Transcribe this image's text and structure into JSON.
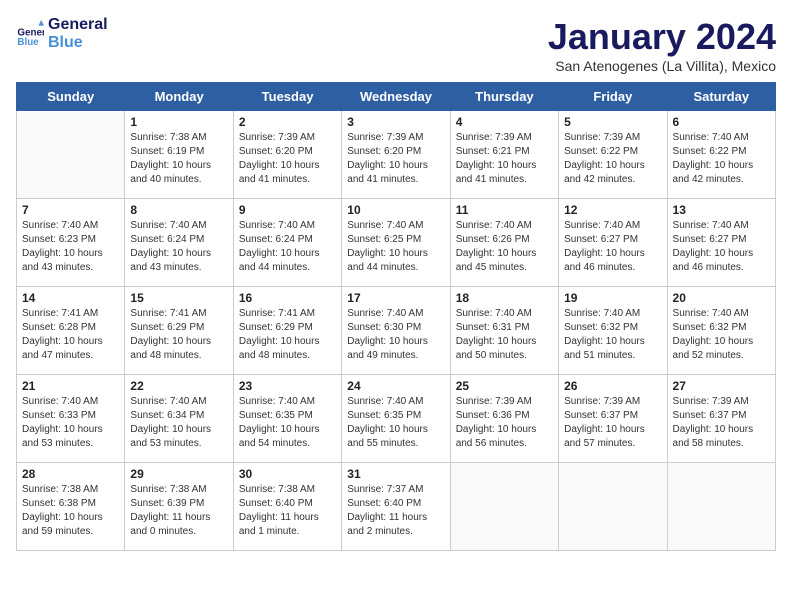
{
  "header": {
    "logo_line1": "General",
    "logo_line2": "Blue",
    "month_title": "January 2024",
    "location": "San Atenogenes (La Villita), Mexico"
  },
  "days_of_week": [
    "Sunday",
    "Monday",
    "Tuesday",
    "Wednesday",
    "Thursday",
    "Friday",
    "Saturday"
  ],
  "weeks": [
    [
      {
        "day": "",
        "info": ""
      },
      {
        "day": "1",
        "info": "Sunrise: 7:38 AM\nSunset: 6:19 PM\nDaylight: 10 hours\nand 40 minutes."
      },
      {
        "day": "2",
        "info": "Sunrise: 7:39 AM\nSunset: 6:20 PM\nDaylight: 10 hours\nand 41 minutes."
      },
      {
        "day": "3",
        "info": "Sunrise: 7:39 AM\nSunset: 6:20 PM\nDaylight: 10 hours\nand 41 minutes."
      },
      {
        "day": "4",
        "info": "Sunrise: 7:39 AM\nSunset: 6:21 PM\nDaylight: 10 hours\nand 41 minutes."
      },
      {
        "day": "5",
        "info": "Sunrise: 7:39 AM\nSunset: 6:22 PM\nDaylight: 10 hours\nand 42 minutes."
      },
      {
        "day": "6",
        "info": "Sunrise: 7:40 AM\nSunset: 6:22 PM\nDaylight: 10 hours\nand 42 minutes."
      }
    ],
    [
      {
        "day": "7",
        "info": "Sunrise: 7:40 AM\nSunset: 6:23 PM\nDaylight: 10 hours\nand 43 minutes."
      },
      {
        "day": "8",
        "info": "Sunrise: 7:40 AM\nSunset: 6:24 PM\nDaylight: 10 hours\nand 43 minutes."
      },
      {
        "day": "9",
        "info": "Sunrise: 7:40 AM\nSunset: 6:24 PM\nDaylight: 10 hours\nand 44 minutes."
      },
      {
        "day": "10",
        "info": "Sunrise: 7:40 AM\nSunset: 6:25 PM\nDaylight: 10 hours\nand 44 minutes."
      },
      {
        "day": "11",
        "info": "Sunrise: 7:40 AM\nSunset: 6:26 PM\nDaylight: 10 hours\nand 45 minutes."
      },
      {
        "day": "12",
        "info": "Sunrise: 7:40 AM\nSunset: 6:27 PM\nDaylight: 10 hours\nand 46 minutes."
      },
      {
        "day": "13",
        "info": "Sunrise: 7:40 AM\nSunset: 6:27 PM\nDaylight: 10 hours\nand 46 minutes."
      }
    ],
    [
      {
        "day": "14",
        "info": "Sunrise: 7:41 AM\nSunset: 6:28 PM\nDaylight: 10 hours\nand 47 minutes."
      },
      {
        "day": "15",
        "info": "Sunrise: 7:41 AM\nSunset: 6:29 PM\nDaylight: 10 hours\nand 48 minutes."
      },
      {
        "day": "16",
        "info": "Sunrise: 7:41 AM\nSunset: 6:29 PM\nDaylight: 10 hours\nand 48 minutes."
      },
      {
        "day": "17",
        "info": "Sunrise: 7:40 AM\nSunset: 6:30 PM\nDaylight: 10 hours\nand 49 minutes."
      },
      {
        "day": "18",
        "info": "Sunrise: 7:40 AM\nSunset: 6:31 PM\nDaylight: 10 hours\nand 50 minutes."
      },
      {
        "day": "19",
        "info": "Sunrise: 7:40 AM\nSunset: 6:32 PM\nDaylight: 10 hours\nand 51 minutes."
      },
      {
        "day": "20",
        "info": "Sunrise: 7:40 AM\nSunset: 6:32 PM\nDaylight: 10 hours\nand 52 minutes."
      }
    ],
    [
      {
        "day": "21",
        "info": "Sunrise: 7:40 AM\nSunset: 6:33 PM\nDaylight: 10 hours\nand 53 minutes."
      },
      {
        "day": "22",
        "info": "Sunrise: 7:40 AM\nSunset: 6:34 PM\nDaylight: 10 hours\nand 53 minutes."
      },
      {
        "day": "23",
        "info": "Sunrise: 7:40 AM\nSunset: 6:35 PM\nDaylight: 10 hours\nand 54 minutes."
      },
      {
        "day": "24",
        "info": "Sunrise: 7:40 AM\nSunset: 6:35 PM\nDaylight: 10 hours\nand 55 minutes."
      },
      {
        "day": "25",
        "info": "Sunrise: 7:39 AM\nSunset: 6:36 PM\nDaylight: 10 hours\nand 56 minutes."
      },
      {
        "day": "26",
        "info": "Sunrise: 7:39 AM\nSunset: 6:37 PM\nDaylight: 10 hours\nand 57 minutes."
      },
      {
        "day": "27",
        "info": "Sunrise: 7:39 AM\nSunset: 6:37 PM\nDaylight: 10 hours\nand 58 minutes."
      }
    ],
    [
      {
        "day": "28",
        "info": "Sunrise: 7:38 AM\nSunset: 6:38 PM\nDaylight: 10 hours\nand 59 minutes."
      },
      {
        "day": "29",
        "info": "Sunrise: 7:38 AM\nSunset: 6:39 PM\nDaylight: 11 hours\nand 0 minutes."
      },
      {
        "day": "30",
        "info": "Sunrise: 7:38 AM\nSunset: 6:40 PM\nDaylight: 11 hours\nand 1 minute."
      },
      {
        "day": "31",
        "info": "Sunrise: 7:37 AM\nSunset: 6:40 PM\nDaylight: 11 hours\nand 2 minutes."
      },
      {
        "day": "",
        "info": ""
      },
      {
        "day": "",
        "info": ""
      },
      {
        "day": "",
        "info": ""
      }
    ]
  ]
}
